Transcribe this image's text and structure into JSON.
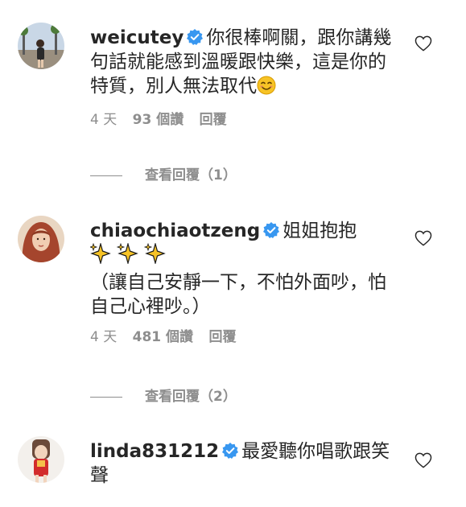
{
  "colors": {
    "text": "#262626",
    "muted": "#8e8e8e",
    "verified": "#3897f0"
  },
  "comments": [
    {
      "username": "weicutey",
      "text": "你很棒啊關，跟你講幾句話就能感到溫暖跟快樂，這是你的特質，別人無法取代",
      "emoji": "smiling-face-emoji",
      "time": "4 天",
      "likes": "93 個讚",
      "reply": "回覆",
      "view_replies": "查看回覆（1）"
    },
    {
      "username": "chiaochiaotzeng",
      "text_line1": "姐姐抱抱",
      "sparkles": "sparkles-emoji",
      "text_line2": "（讓自己安靜一下，不怕外面吵，怕自己心裡吵。）",
      "time": "4 天",
      "likes": "481 個讚",
      "reply": "回覆",
      "view_replies": "查看回覆（2）"
    },
    {
      "username": "linda831212",
      "text": "最愛聽你唱歌跟笑聲"
    }
  ]
}
